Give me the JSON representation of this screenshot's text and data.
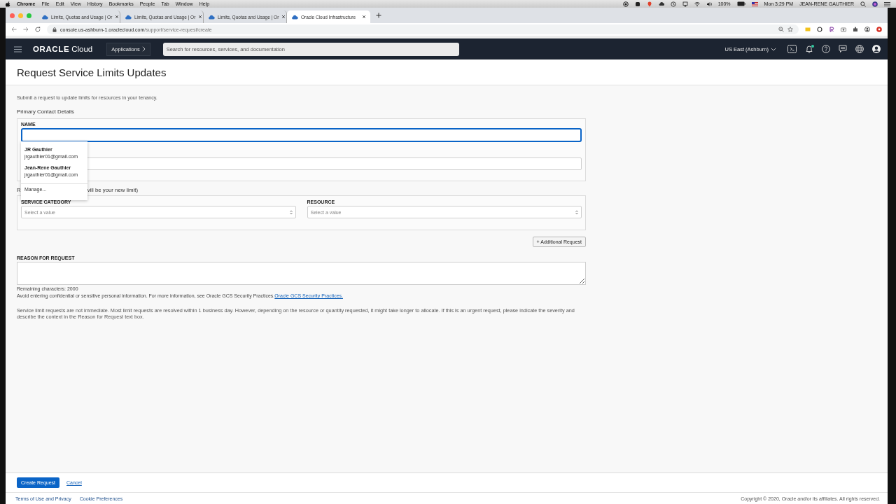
{
  "menubar": {
    "app": "Chrome",
    "menus": [
      "File",
      "Edit",
      "View",
      "History",
      "Bookmarks",
      "People",
      "Tab",
      "Window",
      "Help"
    ],
    "battery": "100%",
    "clock": "Mon 3:29 PM",
    "user": "JEAN-RENE GAUTHIER"
  },
  "browser": {
    "tabs": [
      {
        "title": "Limits, Quotas and Usage | Or",
        "selected": false
      },
      {
        "title": "Limits, Quotas and Usage | Or",
        "selected": false
      },
      {
        "title": "Limits, Quotas and Usage | Or",
        "selected": false
      },
      {
        "title": "Oracle Cloud Infrastructure",
        "selected": true
      }
    ],
    "url_host": "console.us-ashburn-1.oraclecloud.com",
    "url_path": "/support/service-request/create"
  },
  "header": {
    "logo_brand": "ORACLE",
    "logo_product": "Cloud",
    "applications": "Applications",
    "search_placeholder": "Search for resources, services, and documentation",
    "region": "US East (Ashburn)",
    "notifications": true
  },
  "page": {
    "title": "Request Service Limits Updates",
    "intro": "Submit a request to update limits for resources in your tenancy.",
    "contact_heading": "Primary Contact Details",
    "name_label": "NAME",
    "name_focused": true,
    "autocomplete": [
      {
        "name": "JR Gauthier",
        "email": "jrgauthier01@gmail.com"
      },
      {
        "name": "Jean-Rene Gauthier",
        "email": "jrgauthier01@gmail.com"
      }
    ],
    "autocomplete_manage": "Manage...",
    "request_heading_parts": [
      "R",
      "vill be your new limit)"
    ],
    "selects": [
      {
        "label": "SERVICE CATEGORY",
        "placeholder": "Select a value"
      },
      {
        "label": "RESOURCE",
        "placeholder": "Select a value"
      }
    ],
    "additional_button": "+ Additional Request",
    "reason_label": "REASON FOR REQUEST",
    "remaining": "Remaining characters: 2000",
    "disclaimer": "Avoid entering confidential or sensitive personal information. For more information, see Oracle GCS Security Practices.",
    "disclaimer_link": "Oracle GCS Security Practices.",
    "note": "Service limit requests are not immediate. Most limit requests are resolved within 1 business day. However, depending on the resource or quantity requested, it might take longer to allocate. If this is an urgent request, please indicate the severity and describe the context in the Reason for Request text box."
  },
  "actions": {
    "primary": "Create Request",
    "cancel": "Cancel"
  },
  "footer": {
    "links": [
      "Terms of Use and Privacy",
      "Cookie Preferences"
    ],
    "copyright": "Copyright © 2020, Oracle and/or its affiliates. All rights reserved."
  }
}
